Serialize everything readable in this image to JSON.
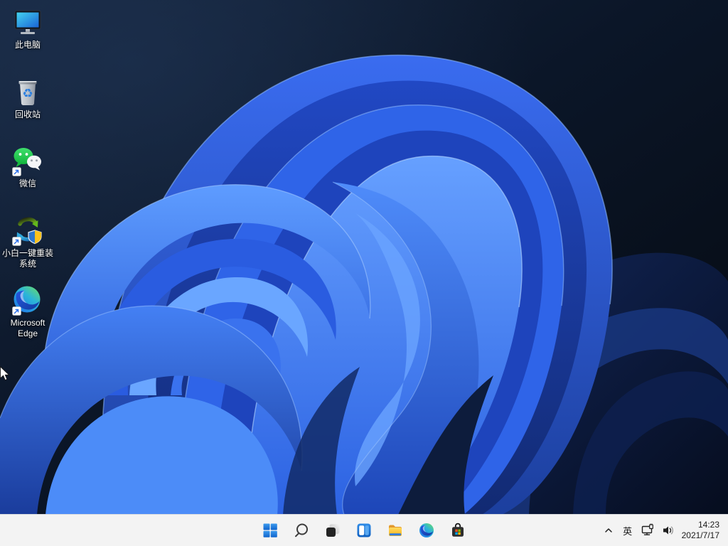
{
  "wallpaper": {
    "name": "windows-11-bloom",
    "background_color": "#0a1424",
    "bloom_accent": "#3b76f0"
  },
  "desktop_icons": [
    {
      "id": "this-pc",
      "icon": "monitor-icon",
      "label_line1": "此电脑",
      "label_line2": "",
      "shortcut": false
    },
    {
      "id": "recycle-bin",
      "icon": "recycle-bin-icon",
      "label_line1": "回收站",
      "label_line2": "",
      "shortcut": false
    },
    {
      "id": "wechat",
      "icon": "wechat-icon",
      "label_line1": "微信",
      "label_line2": "",
      "shortcut": true
    },
    {
      "id": "xiaobai-reinstall",
      "icon": "xiaobai-icon",
      "label_line1": "小白一键重装",
      "label_line2": "系统",
      "shortcut": true
    },
    {
      "id": "microsoft-edge",
      "icon": "edge-icon",
      "label_line1": "Microsoft",
      "label_line2": "Edge",
      "shortcut": true
    }
  ],
  "taskbar": {
    "background": "#f3f3f3",
    "buttons": [
      {
        "id": "start",
        "icon": "windows-start-icon"
      },
      {
        "id": "search",
        "icon": "search-icon"
      },
      {
        "id": "task-view",
        "icon": "task-view-icon"
      },
      {
        "id": "widgets",
        "icon": "widgets-icon"
      },
      {
        "id": "file-explorer",
        "icon": "file-explorer-icon"
      },
      {
        "id": "edge-browser",
        "icon": "edge-icon"
      },
      {
        "id": "store",
        "icon": "store-icon"
      }
    ],
    "tray": {
      "chevron_icon": "chevron-up-icon",
      "ime_label": "英",
      "network_icon": "ethernet-icon",
      "volume_icon": "speaker-icon",
      "time": "14:23",
      "date": "2021/7/17"
    },
    "colors": {
      "start_blue": "#1573d6",
      "icon_dark": "#1f1f1f",
      "store_red": "#f25022",
      "store_green": "#7fba00",
      "store_blue": "#00a4ef",
      "store_yellow": "#ffb900"
    }
  }
}
